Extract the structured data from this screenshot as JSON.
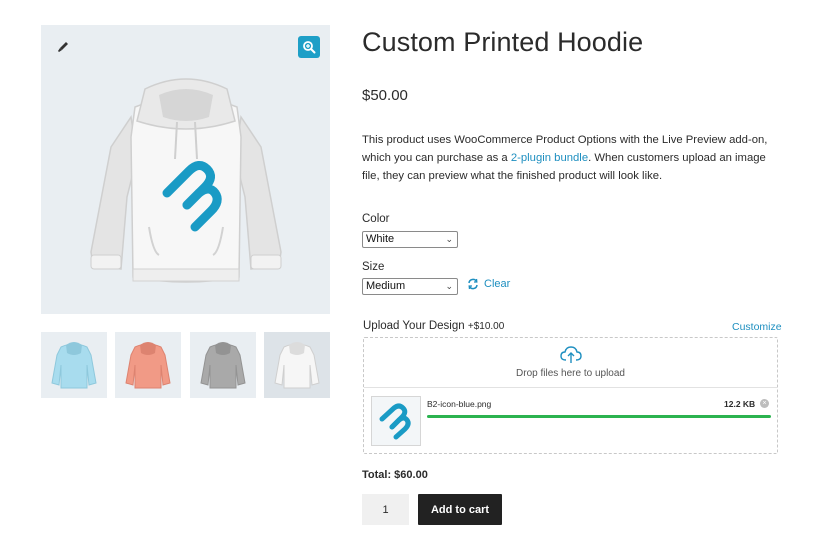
{
  "product": {
    "title": "Custom Printed Hoodie",
    "price": "$50.00",
    "description_before": "This product uses WooCommerce Product Options with the Live Preview add-on, which you can purchase as a ",
    "description_link": "2-plugin bundle",
    "description_after": ". When customers upload an image file, they can preview what the finished product will look like."
  },
  "gallery": {
    "thumbnails": [
      {
        "color_name": "light blue",
        "color": "#a8dcee"
      },
      {
        "color_name": "coral",
        "color": "#f19a86"
      },
      {
        "color_name": "gray",
        "color": "#a9a9a9"
      },
      {
        "color_name": "white",
        "color": "#f6f6f6"
      }
    ],
    "icons": {
      "brush": "brush-icon",
      "zoom": "zoom-icon"
    }
  },
  "options": {
    "color_label": "Color",
    "color_value": "White",
    "size_label": "Size",
    "size_value": "Medium",
    "clear_label": "Clear"
  },
  "upload": {
    "label": "Upload Your Design",
    "extra_price": "+$10.00",
    "customize_label": "Customize",
    "drop_text": "Drop files here to upload",
    "file": {
      "name": "B2-icon-blue.png",
      "size": "12.2 KB",
      "progress": 1.0
    }
  },
  "cart": {
    "total": "Total: $60.00",
    "quantity": "1",
    "add_label": "Add to cart"
  },
  "colors": {
    "accent": "#1e9fc7",
    "link": "#1e8fc0",
    "progress": "#2bb34f",
    "button": "#222222"
  }
}
